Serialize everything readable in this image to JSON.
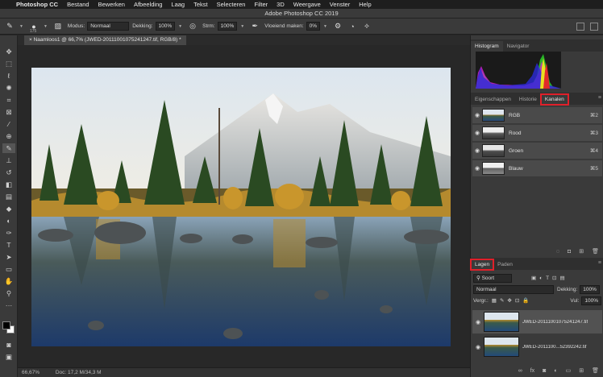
{
  "menubar": {
    "app": "Photoshop CC",
    "items": [
      "Bestand",
      "Bewerken",
      "Afbeelding",
      "Laag",
      "Tekst",
      "Selecteren",
      "Filter",
      "3D",
      "Weergave",
      "Venster",
      "Help"
    ]
  },
  "window_title": "Adobe Photoshop CC 2019",
  "options": {
    "brush_size": "175",
    "mode_label": "Modus:",
    "mode_value": "Normaal",
    "opacity_label": "Dekking:",
    "opacity_value": "100%",
    "flow_label": "Strm:",
    "flow_value": "100%",
    "smoothing_label": "Vloeiend maken:",
    "smoothing_value": "0%"
  },
  "document_tab": "Naamloos1 @ 66,7% (JWED-20111001075241247.tif, RGB/8) *",
  "status": {
    "zoom": "66,67%",
    "doc": "Doc: 17,2 M/34,3 M"
  },
  "panels": {
    "top_tabs": [
      "Histogram",
      "Navigator"
    ],
    "mid_tabs": [
      "Eigenschappen",
      "Historie",
      "Kanalen"
    ],
    "channels": [
      {
        "name": "RGB",
        "shortcut": "⌘2"
      },
      {
        "name": "Rood",
        "shortcut": "⌘3"
      },
      {
        "name": "Groen",
        "shortcut": "⌘4"
      },
      {
        "name": "Blauw",
        "shortcut": "⌘5"
      }
    ],
    "layer_tabs": [
      "Lagen",
      "Paden"
    ],
    "filter_kind": "Soort",
    "blend_mode": "Normaal",
    "opacity_label": "Dekking:",
    "opacity_value": "100%",
    "lock_label": "Vergr.:",
    "fill_label": "Vul:",
    "fill_value": "100%",
    "layers": [
      {
        "name": "JWED-20111001075241247.tif"
      },
      {
        "name": "JWED-2011100...52392242.tif"
      }
    ]
  },
  "colors": {
    "highlight": "#e0202a",
    "panel": "#3a3a3a"
  }
}
